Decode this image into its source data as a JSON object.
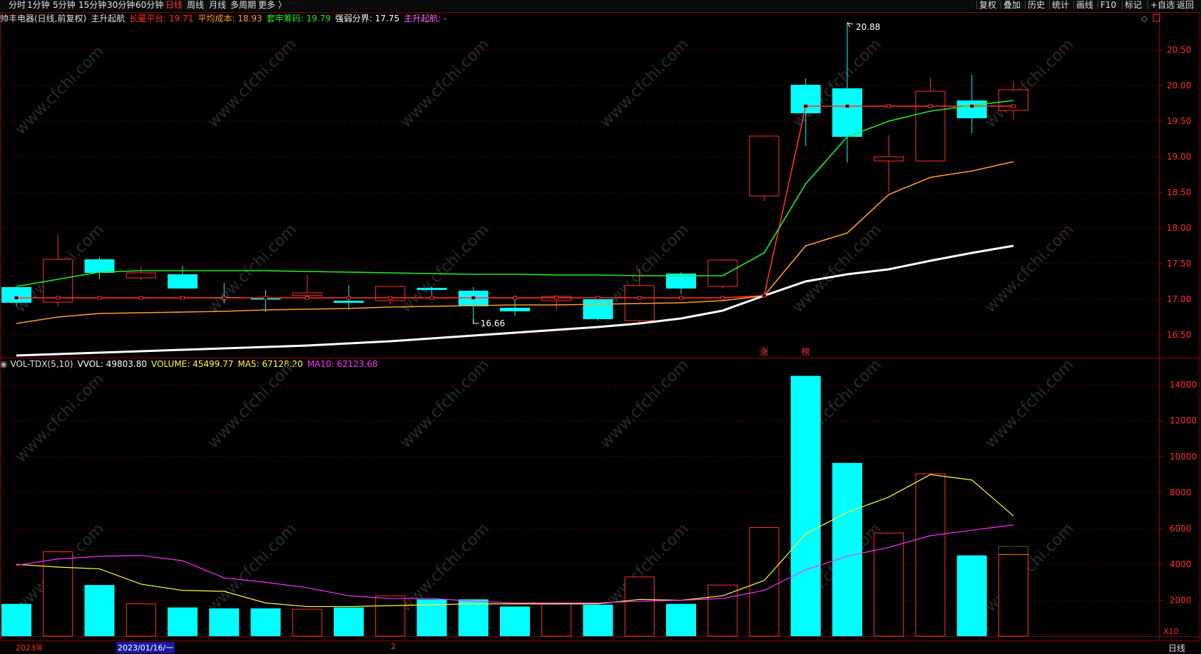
{
  "toolbar": {
    "left_items": [
      "分时",
      "1分钟",
      "5分钟",
      "15分钟",
      "30分钟",
      "60分钟",
      "日线",
      "周线",
      "月线",
      "多周期",
      "更多 〉"
    ],
    "active_item": "日线",
    "right_items": [
      "复权",
      "叠加",
      "历史",
      "统计",
      "画线",
      "F10",
      "标记",
      "+自选",
      "返回"
    ]
  },
  "header_main": {
    "stock": "帅丰电器(日线,前复权)",
    "indicator": "主升起航",
    "items": [
      {
        "label": "长量平台: ",
        "value": "19.71",
        "color": "#ff3030"
      },
      {
        "label": "平均成本: ",
        "value": "18.93",
        "color": "#ff9c2a"
      },
      {
        "label": "套牢筹码: ",
        "value": "19.79",
        "color": "#22ee22"
      },
      {
        "label": "强弱分界: ",
        "value": "17.75",
        "color": "#ffffff"
      },
      {
        "label": "主升起航: ",
        "value": "-",
        "color": "#ff66ff"
      }
    ]
  },
  "header_vol": {
    "name": "VOL-TDX(5,10)",
    "items": [
      {
        "label": "VVOL: ",
        "value": "49803.80",
        "color": "#ffffff"
      },
      {
        "label": "VOLUME: ",
        "value": "45499.77",
        "color": "#ffff33"
      },
      {
        "label": "MA5: ",
        "value": "67128.20",
        "color": "#ffff33"
      },
      {
        "label": "MA10: ",
        "value": "62123.68",
        "color": "#ff33ff"
      }
    ]
  },
  "chart_data": {
    "type": "candlestick",
    "price_ylim": [
      16.2,
      20.9
    ],
    "price_ticks": [
      "16.50",
      "17.00",
      "17.50",
      "18.00",
      "18.50",
      "19.00",
      "19.50",
      "20.00",
      "20.50"
    ],
    "vol_ylim": [
      0,
      14800
    ],
    "vol_ticks": [
      "2000",
      "4000",
      "6000",
      "8000",
      "10000",
      "12000",
      "14000"
    ],
    "vol_unit_label": "X10",
    "annotations": {
      "high": "20.88",
      "low": "16.66"
    },
    "signal_labels": [
      "涨",
      "榜"
    ],
    "candles": [
      {
        "o": 17.17,
        "h": 17.17,
        "l": 16.9,
        "c": 16.95,
        "down": true
      },
      {
        "o": 16.96,
        "h": 17.9,
        "l": 16.9,
        "c": 17.56,
        "down": false
      },
      {
        "o": 17.56,
        "h": 17.59,
        "l": 17.28,
        "c": 17.37,
        "down": true
      },
      {
        "o": 17.3,
        "h": 17.46,
        "l": 17.26,
        "c": 17.37,
        "down": false
      },
      {
        "o": 17.35,
        "h": 17.47,
        "l": 17.15,
        "c": 17.15,
        "down": true
      },
      {
        "o": 17.03,
        "h": 17.23,
        "l": 16.94,
        "c": 17.02,
        "down": true
      },
      {
        "o": 17.01,
        "h": 17.13,
        "l": 16.82,
        "c": 17.0,
        "down": true
      },
      {
        "o": 17.05,
        "h": 17.34,
        "l": 17.03,
        "c": 17.09,
        "down": false
      },
      {
        "o": 16.98,
        "h": 17.2,
        "l": 16.85,
        "c": 16.95,
        "down": true
      },
      {
        "o": 16.98,
        "h": 17.18,
        "l": 16.93,
        "c": 17.18,
        "down": false
      },
      {
        "o": 17.16,
        "h": 17.18,
        "l": 17.05,
        "c": 17.13,
        "down": true
      },
      {
        "o": 17.12,
        "h": 17.17,
        "l": 16.66,
        "c": 16.9,
        "down": true
      },
      {
        "o": 16.88,
        "h": 17.05,
        "l": 16.76,
        "c": 16.83,
        "down": true
      },
      {
        "o": 16.98,
        "h": 17.06,
        "l": 16.85,
        "c": 17.04,
        "down": false
      },
      {
        "o": 17.0,
        "h": 17.02,
        "l": 16.7,
        "c": 16.72,
        "down": true
      },
      {
        "o": 16.7,
        "h": 17.42,
        "l": 16.68,
        "c": 17.19,
        "down": false
      },
      {
        "o": 17.36,
        "h": 17.38,
        "l": 17.07,
        "c": 17.15,
        "down": true
      },
      {
        "o": 17.18,
        "h": 17.57,
        "l": 17.15,
        "c": 17.55,
        "down": false
      },
      {
        "o": 18.45,
        "h": 19.3,
        "l": 18.38,
        "c": 19.29,
        "down": false
      },
      {
        "o": 20.01,
        "h": 20.1,
        "l": 19.15,
        "c": 19.61,
        "down": true
      },
      {
        "o": 19.96,
        "h": 20.88,
        "l": 18.92,
        "c": 19.28,
        "down": true
      },
      {
        "o": 18.94,
        "h": 19.3,
        "l": 18.5,
        "c": 19.0,
        "down": false
      },
      {
        "o": 18.94,
        "h": 20.1,
        "l": 18.94,
        "c": 19.92,
        "down": false
      },
      {
        "o": 19.79,
        "h": 20.15,
        "l": 19.33,
        "c": 19.54,
        "down": true
      },
      {
        "o": 19.65,
        "h": 20.06,
        "l": 19.52,
        "c": 19.94,
        "down": false
      }
    ],
    "series": [
      {
        "name": "长量平台",
        "color": "#ff3030",
        "values": [
          17.02,
          17.02,
          17.02,
          17.02,
          17.02,
          17.02,
          17.02,
          17.02,
          17.02,
          17.02,
          17.02,
          17.02,
          17.02,
          17.02,
          17.02,
          17.02,
          17.02,
          17.02,
          17.05,
          19.71,
          19.71,
          19.71,
          19.71,
          19.71,
          19.71
        ]
      },
      {
        "name": "平均成本",
        "color": "#ff9c2a",
        "values": [
          16.66,
          16.75,
          16.8,
          16.81,
          16.82,
          16.83,
          16.85,
          16.86,
          16.87,
          16.89,
          16.9,
          16.91,
          16.92,
          16.92,
          16.93,
          16.94,
          16.95,
          16.98,
          17.05,
          17.75,
          17.93,
          18.47,
          18.71,
          18.8,
          18.93
        ]
      },
      {
        "name": "套牢筹码",
        "color": "#22ee22",
        "values": [
          17.18,
          17.28,
          17.38,
          17.4,
          17.4,
          17.4,
          17.4,
          17.39,
          17.38,
          17.37,
          17.36,
          17.35,
          17.35,
          17.34,
          17.34,
          17.33,
          17.33,
          17.33,
          17.65,
          18.62,
          19.28,
          19.5,
          19.64,
          19.72,
          19.79
        ]
      },
      {
        "name": "强弱分界",
        "color": "#ffffff",
        "values": [
          16.21,
          16.23,
          16.25,
          16.27,
          16.29,
          16.31,
          16.33,
          16.35,
          16.38,
          16.41,
          16.45,
          16.49,
          16.53,
          16.57,
          16.61,
          16.66,
          16.73,
          16.84,
          17.05,
          17.25,
          17.35,
          17.42,
          17.54,
          17.65,
          17.75
        ]
      }
    ],
    "volume": [
      {
        "v": 1800,
        "down": true
      },
      {
        "v": 4700,
        "down": false
      },
      {
        "v": 2850,
        "down": true
      },
      {
        "v": 1800,
        "down": false
      },
      {
        "v": 1600,
        "down": true
      },
      {
        "v": 1550,
        "down": true
      },
      {
        "v": 1550,
        "down": true
      },
      {
        "v": 1500,
        "down": false
      },
      {
        "v": 1600,
        "down": true
      },
      {
        "v": 2250,
        "down": false
      },
      {
        "v": 2050,
        "down": true
      },
      {
        "v": 2050,
        "down": true
      },
      {
        "v": 1650,
        "down": true
      },
      {
        "v": 1800,
        "down": false
      },
      {
        "v": 1750,
        "down": true
      },
      {
        "v": 3300,
        "down": false
      },
      {
        "v": 1800,
        "down": true
      },
      {
        "v": 2850,
        "down": false
      },
      {
        "v": 6050,
        "down": false
      },
      {
        "v": 14500,
        "down": true
      },
      {
        "v": 9650,
        "down": true
      },
      {
        "v": 5750,
        "down": false
      },
      {
        "v": 9050,
        "down": false
      },
      {
        "v": 4500,
        "down": true
      },
      {
        "v": 4550,
        "down": false
      }
    ],
    "vol_ma5": [
      4000,
      3850,
      3750,
      2900,
      2550,
      2500,
      1850,
      1650,
      1650,
      1700,
      1750,
      1800,
      1800,
      1800,
      1800,
      2050,
      2000,
      2250,
      3100,
      5700,
      6900,
      7750,
      9000,
      8700,
      6700
    ],
    "vol_ma10": [
      3950,
      4300,
      4450,
      4500,
      4200,
      3250,
      3000,
      2700,
      2250,
      2100,
      2100,
      1950,
      1850,
      1850,
      1850,
      1950,
      2000,
      2100,
      2550,
      3700,
      4450,
      4950,
      5600,
      5900,
      6200
    ],
    "date_labels": [
      {
        "text": "2023年",
        "color": "#ff3030"
      },
      {
        "text": "2023/01/16/一",
        "color": "#ffffff"
      },
      {
        "text": "2",
        "color": "#ff3030"
      }
    ],
    "period_button": "日线"
  }
}
